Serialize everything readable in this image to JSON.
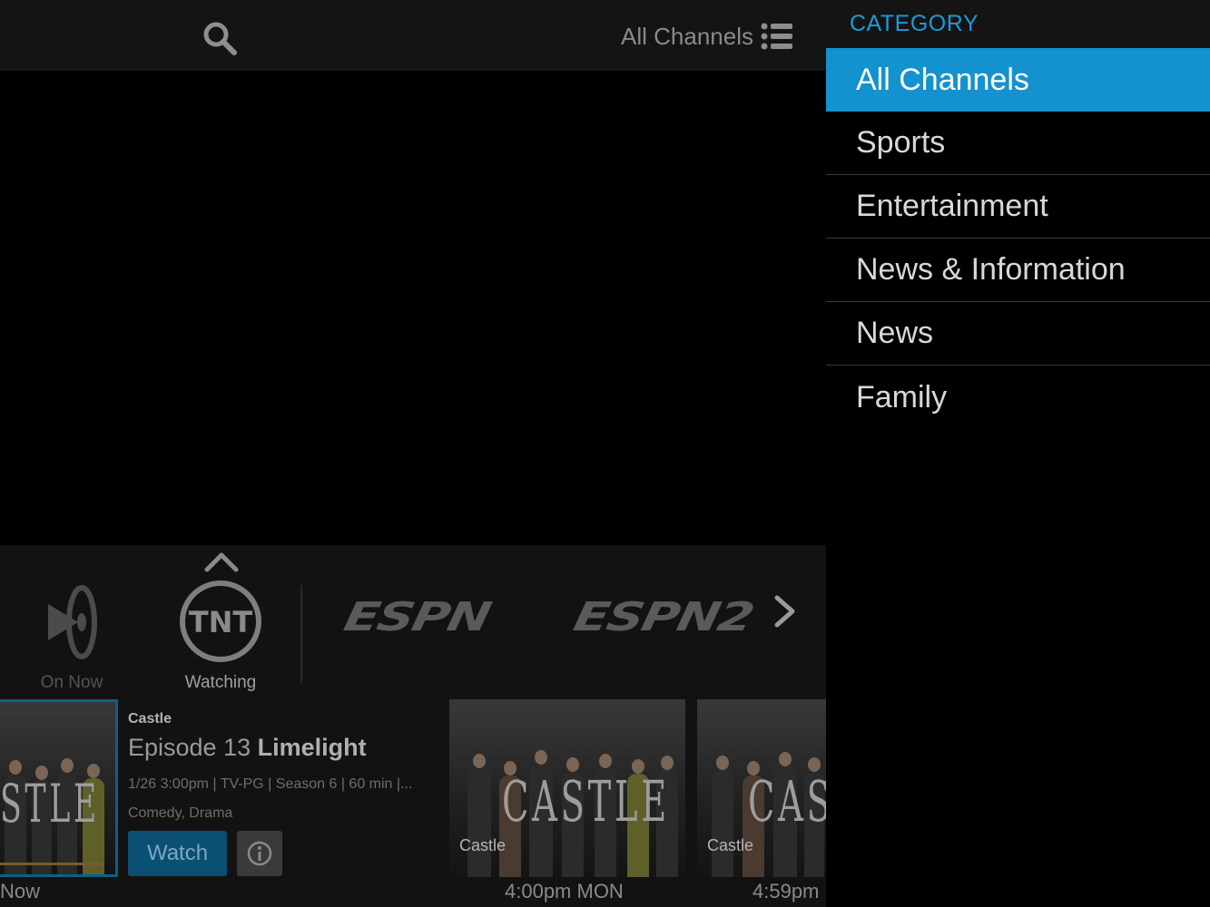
{
  "header": {
    "channels_label": "All Channels"
  },
  "channels": {
    "on_now_label": "On Now",
    "watching_label": "Watching",
    "tnt_logo_text": "TNT",
    "espn_logo_text": "ESPN",
    "espn2_logo_text": "ESPN2"
  },
  "program": {
    "show": "Castle",
    "episode_prefix": "Episode 13",
    "episode_title": "Limelight",
    "meta": "1/26 3:00pm | TV-PG | Season 6 | 60 min |...",
    "genre": "Comedy, Drama",
    "watch_label": "Watch",
    "progress": 0.9,
    "time_label": "Now"
  },
  "upcoming": [
    {
      "title": "Castle",
      "time": "4:00pm MON"
    },
    {
      "title": "Castle",
      "time": "4:59pm"
    }
  ],
  "thumb_art_text": "CASTLE",
  "category": {
    "title": "CATEGORY",
    "items": [
      {
        "label": "All Channels",
        "active": true
      },
      {
        "label": "Sports",
        "active": false
      },
      {
        "label": "Entertainment",
        "active": false
      },
      {
        "label": "News & Information",
        "active": false
      },
      {
        "label": "News",
        "active": false
      },
      {
        "label": "Family",
        "active": false
      }
    ]
  },
  "colors": {
    "accent": "#1491cf",
    "category_title": "#1e9ad6",
    "watch_button": "#0b4f73"
  },
  "icons": [
    "search-icon",
    "list-icon",
    "chevron-up-icon",
    "chevron-right-icon",
    "info-icon",
    "on-now-icon"
  ]
}
